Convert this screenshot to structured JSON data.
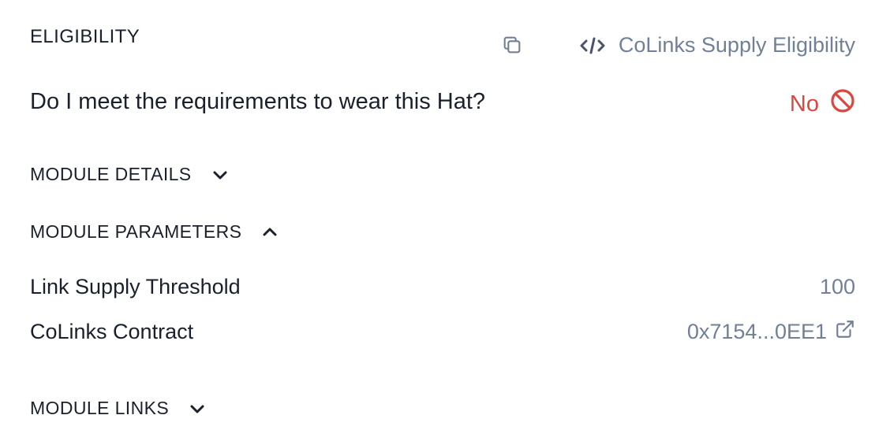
{
  "header": {
    "title": "ELIGIBILITY",
    "module_name": "CoLinks Supply Eligibility"
  },
  "question": {
    "text": "Do I meet the requirements to wear this Hat?",
    "answer": "No",
    "answer_color": "#d9473f"
  },
  "sections": {
    "details_label": "MODULE DETAILS",
    "parameters_label": "MODULE PARAMETERS",
    "links_label": "MODULE LINKS"
  },
  "parameters": [
    {
      "label": "Link Supply Threshold",
      "value": "100"
    },
    {
      "label": "CoLinks Contract",
      "value": "0x7154...0EE1"
    }
  ],
  "icons": {
    "copy": "copy-icon",
    "code": "code-icon",
    "not_allowed": "no-entry-icon",
    "chevron_down": "chevron-down-icon",
    "chevron_up": "chevron-up-icon",
    "external_link": "external-link-icon"
  },
  "colors": {
    "muted": "#718096",
    "text": "#1a202c",
    "negative": "#d9473f"
  }
}
